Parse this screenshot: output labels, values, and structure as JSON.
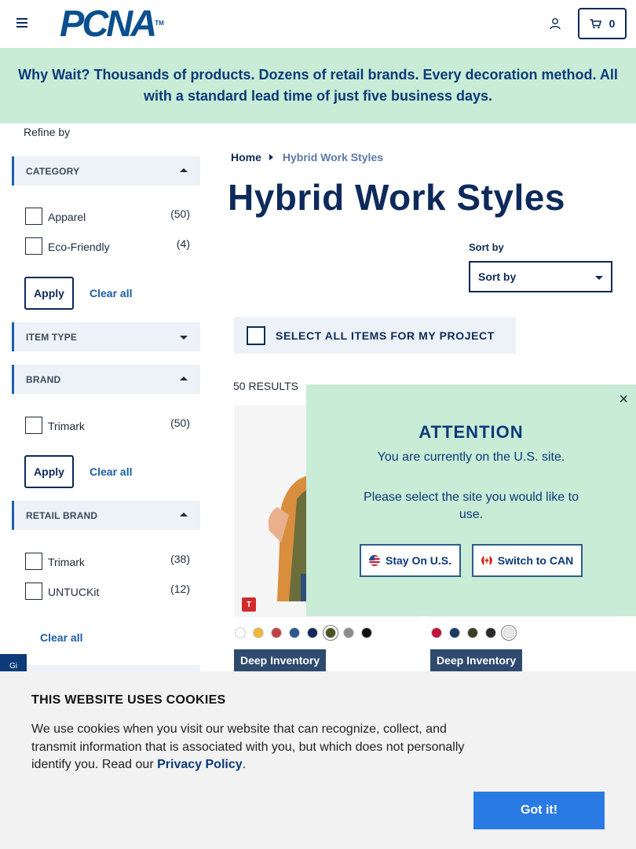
{
  "header": {
    "logo_text": "PCNA",
    "logo_tm": "TM",
    "cart_count": "0"
  },
  "banner": {
    "text": "Why Wait? Thousands of products. Dozens of retail brands. Every decoration method. All with a standard lead time of just five business days."
  },
  "sidebar": {
    "refine_label": "Refine by",
    "category": {
      "title": "CATEGORY",
      "options": [
        {
          "label": "Apparel",
          "count": "(50)"
        },
        {
          "label": "Eco-Friendly",
          "count": "(4)"
        }
      ],
      "apply": "Apply",
      "clear": "Clear all"
    },
    "item_type": {
      "title": "ITEM TYPE"
    },
    "brand": {
      "title": "BRAND",
      "options": [
        {
          "label": "Trimark",
          "count": "(50)"
        }
      ],
      "apply": "Apply",
      "clear": "Clear all"
    },
    "retail_brand": {
      "title": "RETAIL BRAND",
      "options": [
        {
          "label": "Trimark",
          "count": "(38)"
        },
        {
          "label": "UNTUCKit",
          "count": "(12)"
        }
      ],
      "clear": "Clear all"
    },
    "side_tab": "Gi"
  },
  "main": {
    "breadcrumb": {
      "home": "Home",
      "current": "Hybrid Work Styles"
    },
    "title": "Hybrid Work Styles",
    "sort_label": "Sort by",
    "sort_value": "Sort by",
    "select_all": "SELECT ALL ITEMS FOR MY PROJECT",
    "results": "50 RESULTS",
    "products": [
      {
        "badge": "Deep Inventory",
        "brand_tag": "T",
        "swatches": [
          "#ffffff",
          "#f0b73a",
          "#c0404a",
          "#2b5a8c",
          "#14275a",
          "#4b5320",
          "#8a8d8f",
          "#111111"
        ],
        "selected_swatch": 5
      },
      {
        "badge": "Deep Inventory",
        "swatches": [
          "#c0143c",
          "#1d3a66",
          "#3b3f22",
          "#2a2a2a",
          "#e8e8e8"
        ],
        "selected_swatch": 4
      }
    ]
  },
  "attention": {
    "title": "ATTENTION",
    "line1": "You are currently on the U.S. site.",
    "line2": "Please select the site you would like to use.",
    "stay_us": "Stay On U.S.",
    "switch_can": "Switch to CAN",
    "close": "×"
  },
  "cookie": {
    "title": "THIS WEBSITE USES COOKIES",
    "text": "We use cookies when you visit our website that can recognize, collect, and transmit information that is associated with you, but which does not personally identify you. Read our",
    "link": "Privacy Policy",
    "period": ".",
    "button": "Got it!"
  }
}
